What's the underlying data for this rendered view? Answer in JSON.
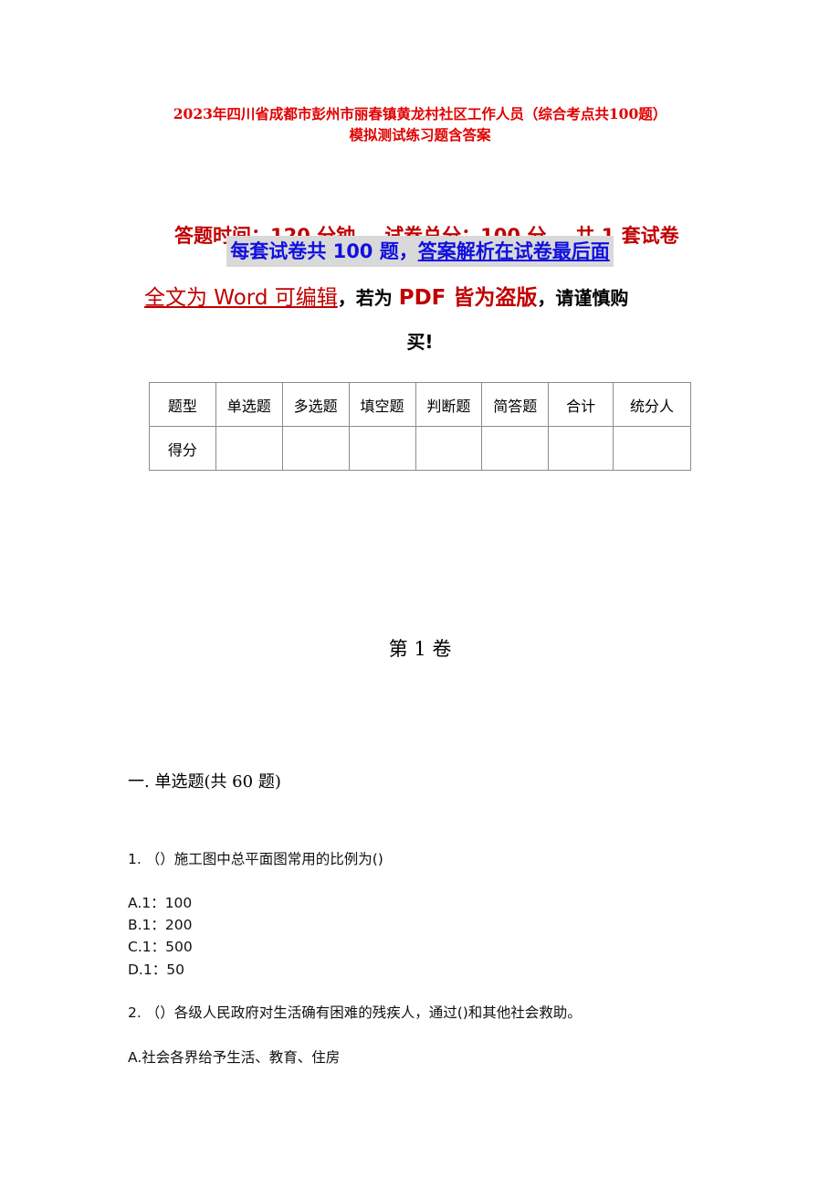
{
  "header": {
    "title_line1": "2023年四川省成都市彭州市丽春镇黄龙村社区工作人员（综合考点共100题）",
    "title_line2": "模拟测试练习题含答案"
  },
  "meta": {
    "time": "答题时间：120 分钟",
    "total_score": "试卷总分：100 分",
    "sets": "共 1 套试卷"
  },
  "notice": {
    "part1": "每套试卷共 100 题，",
    "part2": "答案解析在试卷最后面"
  },
  "edit_notice": {
    "word_part": "全文为 Word 可编辑",
    "comma1": "，",
    "if_part": "若为 ",
    "pdf_part": "PDF 皆为盗版",
    "comma2": "，",
    "careful_part": "请谨慎购",
    "buy_part": "买!"
  },
  "score_table": {
    "header_row": [
      "题型",
      "单选题",
      "多选题",
      "填空题",
      "判断题",
      "简答题",
      "合计",
      "统分人"
    ],
    "score_row": [
      "得分",
      "",
      "",
      "",
      "",
      "",
      "",
      ""
    ]
  },
  "volume_title": "第 1 卷",
  "section_title": "一. 单选题(共 60 题)",
  "questions": [
    {
      "text": "1. （）施工图中总平面图常用的比例为()",
      "options": [
        "A.1：100",
        "B.1：200",
        "C.1：500",
        "D.1：50"
      ]
    },
    {
      "text": "2. （）各级人民政府对生活确有困难的残疾人，通过()和其他社会救助。",
      "options": [
        "A.社会各界给予生活、教育、住房"
      ]
    }
  ],
  "colors": {
    "title_red": "#e00000",
    "meta_red": "#c00000",
    "notice_blue": "#1010e0",
    "notice_bg": "#d9d9d9"
  }
}
